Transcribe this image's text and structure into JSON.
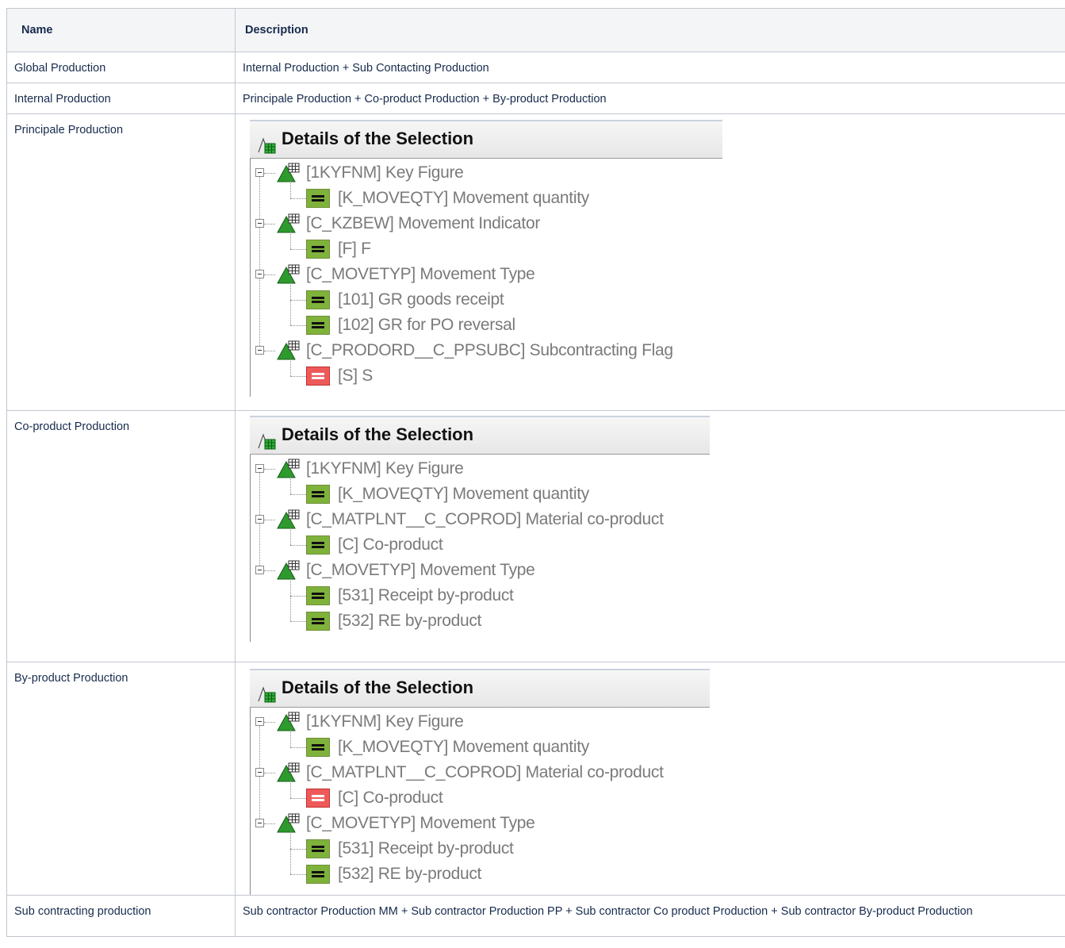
{
  "table": {
    "headers": [
      "Name",
      "Description"
    ],
    "rows": [
      {
        "name": "Global Production",
        "description": "Internal Production + Sub Contacting Production"
      },
      {
        "name": "Internal Production",
        "description": "Principale Production + Co-product Production + By-product Production"
      },
      {
        "name": "Principale Production"
      },
      {
        "name": "Co-product Production"
      },
      {
        "name": "By-product Production"
      },
      {
        "name": "Sub contracting production",
        "description": "Sub contractor Production MM + Sub contractor Production PP + Sub contractor Co product Production + Sub contractor By-product Production"
      }
    ]
  },
  "panels": [
    {
      "title": "Details of the Selection",
      "nodes": [
        {
          "level": 0,
          "text": "[1KYFNM] Key Figure"
        },
        {
          "level": 1,
          "text": "[K_MOVEQTY] Movement quantity",
          "op": "include"
        },
        {
          "level": 0,
          "text": "[C_KZBEW] Movement Indicator"
        },
        {
          "level": 1,
          "text": "[F] F",
          "op": "include"
        },
        {
          "level": 0,
          "text": "[C_MOVETYP] Movement Type"
        },
        {
          "level": 1,
          "text": "[101] GR goods receipt",
          "op": "include"
        },
        {
          "level": 1,
          "text": "[102] GR for PO   reversal",
          "op": "include"
        },
        {
          "level": 0,
          "text": "[C_PRODORD__C_PPSUBC] Subcontracting Flag"
        },
        {
          "level": 1,
          "text": "[S] S",
          "op": "exclude"
        }
      ]
    },
    {
      "title": "Details of the Selection",
      "nodes": [
        {
          "level": 0,
          "text": "[1KYFNM] Key Figure"
        },
        {
          "level": 1,
          "text": "[K_MOVEQTY] Movement quantity",
          "op": "include"
        },
        {
          "level": 0,
          "text": "[C_MATPLNT__C_COPROD] Material co-product"
        },
        {
          "level": 1,
          "text": "[C] Co-product",
          "op": "include"
        },
        {
          "level": 0,
          "text": "[C_MOVETYP] Movement Type"
        },
        {
          "level": 1,
          "text": "[531] Receipt by-product",
          "op": "include"
        },
        {
          "level": 1,
          "text": "[532] RE by-product",
          "op": "include"
        }
      ]
    },
    {
      "title": "Details of the Selection",
      "nodes": [
        {
          "level": 0,
          "text": "[1KYFNM] Key Figure"
        },
        {
          "level": 1,
          "text": "[K_MOVEQTY] Movement quantity",
          "op": "include"
        },
        {
          "level": 0,
          "text": "[C_MATPLNT__C_COPROD] Material co-product"
        },
        {
          "level": 1,
          "text": "[C] Co-product",
          "op": "exclude"
        },
        {
          "level": 0,
          "text": "[C_MOVETYP] Movement Type"
        },
        {
          "level": 1,
          "text": "[531] Receipt by-product",
          "op": "include"
        },
        {
          "level": 1,
          "text": "[532] RE by-product",
          "op": "include"
        }
      ]
    }
  ],
  "icons": {
    "header": "filter-grid-icon",
    "characteristic": "green-triangle-grid-icon",
    "include": "equals-green-icon",
    "exclude": "equals-red-icon",
    "collapse": "minus-box-icon"
  },
  "colors": {
    "include": "#7fb23a",
    "exclude": "#ee5a5a",
    "tree_text": "#7a7a7a",
    "header_bg": "#f4f5f7",
    "border": "#c1c7d0"
  }
}
